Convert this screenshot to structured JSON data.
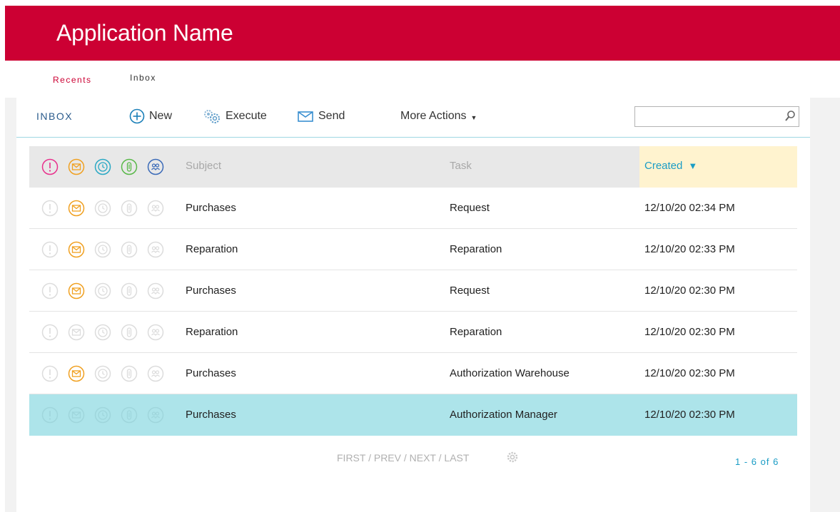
{
  "app": {
    "title": "Application Name"
  },
  "nav": {
    "tabs": [
      {
        "label": "Recents"
      },
      {
        "label": "Inbox"
      }
    ]
  },
  "toolbar": {
    "title": "INBOX",
    "new_label": "New",
    "execute_label": "Execute",
    "send_label": "Send",
    "more_label": "More Actions",
    "search_value": ""
  },
  "grid": {
    "headers": {
      "subject": "Subject",
      "task": "Task",
      "created": "Created"
    },
    "rows": [
      {
        "subject": "Purchases",
        "task": "Request",
        "created": "12/10/20 02:34 PM",
        "unread": true,
        "selected": false
      },
      {
        "subject": "Reparation",
        "task": "Reparation",
        "created": "12/10/20 02:33 PM",
        "unread": true,
        "selected": false
      },
      {
        "subject": "Purchases",
        "task": "Request",
        "created": "12/10/20 02:30 PM",
        "unread": true,
        "selected": false
      },
      {
        "subject": "Reparation",
        "task": "Reparation",
        "created": "12/10/20 02:30 PM",
        "unread": false,
        "selected": false
      },
      {
        "subject": "Purchases",
        "task": "Authorization Warehouse",
        "created": "12/10/20 02:30 PM",
        "unread": true,
        "selected": false
      },
      {
        "subject": "Purchases",
        "task": "Authorization Manager",
        "created": "12/10/20 02:30 PM",
        "unread": false,
        "selected": true
      }
    ]
  },
  "footer": {
    "pager": "FIRST / PREV / NEXT / LAST",
    "count": "1 - 6 of 6"
  },
  "colors": {
    "brand": "#cc0033",
    "priority": "#e8308c",
    "mail": "#f0a020",
    "clock": "#29a8c4",
    "attachment": "#58b848",
    "group": "#3a6ab8",
    "selected_row": "#ade4ea",
    "sorted_header": "#fff3cf"
  }
}
